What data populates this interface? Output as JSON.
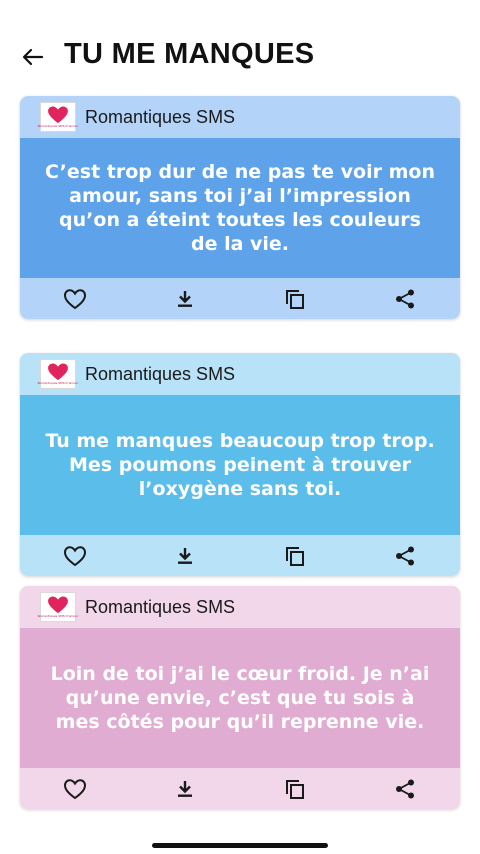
{
  "header": {
    "title": "TU ME MANQUES",
    "back_icon": "arrow-left-icon"
  },
  "cards": [
    {
      "app_name": "Romantiques SMS",
      "logo_text": "Romantiques SMS D'amour",
      "message": "C’est trop dur de ne pas te voir mon amour, sans toi j’ai l’impression qu’on a éteint toutes les couleurs de la vie.",
      "colors": {
        "header": "#b3d4f8",
        "body": "#5ea2ea",
        "actions": "#b3d4f8"
      }
    },
    {
      "app_name": "Romantiques SMS",
      "logo_text": "Romantiques SMS D'amour",
      "message": "Tu me manques beaucoup trop trop. Mes poumons peinent à trouver l’oxygène sans toi.",
      "colors": {
        "header": "#b8e2f8",
        "body": "#5bbde9",
        "actions": "#b8e2f8"
      }
    },
    {
      "app_name": "Romantiques SMS",
      "logo_text": "Romantiques SMS D'amour",
      "message": "Loin de toi j’ai le cœur froid. Je n’ai qu’une envie, c’est que tu sois à mes côtés pour qu’il reprenne vie.",
      "colors": {
        "header": "#f2d6ea",
        "body": "#e0acd1",
        "actions": "#f2d6ea"
      }
    }
  ],
  "actions": [
    "heart-icon",
    "download-icon",
    "copy-icon",
    "share-icon"
  ],
  "icon_color": "#1a1a1a"
}
